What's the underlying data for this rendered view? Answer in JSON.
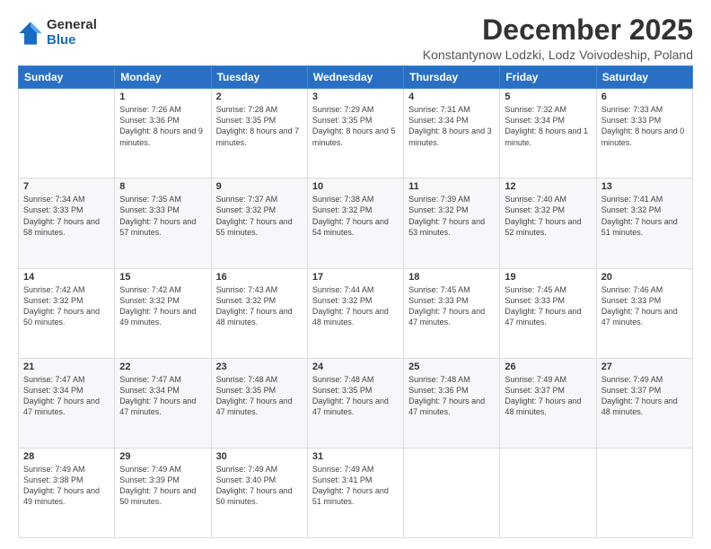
{
  "logo": {
    "general": "General",
    "blue": "Blue"
  },
  "title": "December 2025",
  "subtitle": "Konstantynow Lodzki, Lodz Voivodeship, Poland",
  "days": [
    "Sunday",
    "Monday",
    "Tuesday",
    "Wednesday",
    "Thursday",
    "Friday",
    "Saturday"
  ],
  "weeks": [
    [
      {
        "date": "",
        "sunrise": "",
        "sunset": "",
        "daylight": ""
      },
      {
        "date": "1",
        "sunrise": "Sunrise: 7:26 AM",
        "sunset": "Sunset: 3:36 PM",
        "daylight": "Daylight: 8 hours and 9 minutes."
      },
      {
        "date": "2",
        "sunrise": "Sunrise: 7:28 AM",
        "sunset": "Sunset: 3:35 PM",
        "daylight": "Daylight: 8 hours and 7 minutes."
      },
      {
        "date": "3",
        "sunrise": "Sunrise: 7:29 AM",
        "sunset": "Sunset: 3:35 PM",
        "daylight": "Daylight: 8 hours and 5 minutes."
      },
      {
        "date": "4",
        "sunrise": "Sunrise: 7:31 AM",
        "sunset": "Sunset: 3:34 PM",
        "daylight": "Daylight: 8 hours and 3 minutes."
      },
      {
        "date": "5",
        "sunrise": "Sunrise: 7:32 AM",
        "sunset": "Sunset: 3:34 PM",
        "daylight": "Daylight: 8 hours and 1 minute."
      },
      {
        "date": "6",
        "sunrise": "Sunrise: 7:33 AM",
        "sunset": "Sunset: 3:33 PM",
        "daylight": "Daylight: 8 hours and 0 minutes."
      }
    ],
    [
      {
        "date": "7",
        "sunrise": "Sunrise: 7:34 AM",
        "sunset": "Sunset: 3:33 PM",
        "daylight": "Daylight: 7 hours and 58 minutes."
      },
      {
        "date": "8",
        "sunrise": "Sunrise: 7:35 AM",
        "sunset": "Sunset: 3:33 PM",
        "daylight": "Daylight: 7 hours and 57 minutes."
      },
      {
        "date": "9",
        "sunrise": "Sunrise: 7:37 AM",
        "sunset": "Sunset: 3:32 PM",
        "daylight": "Daylight: 7 hours and 55 minutes."
      },
      {
        "date": "10",
        "sunrise": "Sunrise: 7:38 AM",
        "sunset": "Sunset: 3:32 PM",
        "daylight": "Daylight: 7 hours and 54 minutes."
      },
      {
        "date": "11",
        "sunrise": "Sunrise: 7:39 AM",
        "sunset": "Sunset: 3:32 PM",
        "daylight": "Daylight: 7 hours and 53 minutes."
      },
      {
        "date": "12",
        "sunrise": "Sunrise: 7:40 AM",
        "sunset": "Sunset: 3:32 PM",
        "daylight": "Daylight: 7 hours and 52 minutes."
      },
      {
        "date": "13",
        "sunrise": "Sunrise: 7:41 AM",
        "sunset": "Sunset: 3:32 PM",
        "daylight": "Daylight: 7 hours and 51 minutes."
      }
    ],
    [
      {
        "date": "14",
        "sunrise": "Sunrise: 7:42 AM",
        "sunset": "Sunset: 3:32 PM",
        "daylight": "Daylight: 7 hours and 50 minutes."
      },
      {
        "date": "15",
        "sunrise": "Sunrise: 7:42 AM",
        "sunset": "Sunset: 3:32 PM",
        "daylight": "Daylight: 7 hours and 49 minutes."
      },
      {
        "date": "16",
        "sunrise": "Sunrise: 7:43 AM",
        "sunset": "Sunset: 3:32 PM",
        "daylight": "Daylight: 7 hours and 48 minutes."
      },
      {
        "date": "17",
        "sunrise": "Sunrise: 7:44 AM",
        "sunset": "Sunset: 3:32 PM",
        "daylight": "Daylight: 7 hours and 48 minutes."
      },
      {
        "date": "18",
        "sunrise": "Sunrise: 7:45 AM",
        "sunset": "Sunset: 3:33 PM",
        "daylight": "Daylight: 7 hours and 47 minutes."
      },
      {
        "date": "19",
        "sunrise": "Sunrise: 7:45 AM",
        "sunset": "Sunset: 3:33 PM",
        "daylight": "Daylight: 7 hours and 47 minutes."
      },
      {
        "date": "20",
        "sunrise": "Sunrise: 7:46 AM",
        "sunset": "Sunset: 3:33 PM",
        "daylight": "Daylight: 7 hours and 47 minutes."
      }
    ],
    [
      {
        "date": "21",
        "sunrise": "Sunrise: 7:47 AM",
        "sunset": "Sunset: 3:34 PM",
        "daylight": "Daylight: 7 hours and 47 minutes."
      },
      {
        "date": "22",
        "sunrise": "Sunrise: 7:47 AM",
        "sunset": "Sunset: 3:34 PM",
        "daylight": "Daylight: 7 hours and 47 minutes."
      },
      {
        "date": "23",
        "sunrise": "Sunrise: 7:48 AM",
        "sunset": "Sunset: 3:35 PM",
        "daylight": "Daylight: 7 hours and 47 minutes."
      },
      {
        "date": "24",
        "sunrise": "Sunrise: 7:48 AM",
        "sunset": "Sunset: 3:35 PM",
        "daylight": "Daylight: 7 hours and 47 minutes."
      },
      {
        "date": "25",
        "sunrise": "Sunrise: 7:48 AM",
        "sunset": "Sunset: 3:36 PM",
        "daylight": "Daylight: 7 hours and 47 minutes."
      },
      {
        "date": "26",
        "sunrise": "Sunrise: 7:49 AM",
        "sunset": "Sunset: 3:37 PM",
        "daylight": "Daylight: 7 hours and 48 minutes."
      },
      {
        "date": "27",
        "sunrise": "Sunrise: 7:49 AM",
        "sunset": "Sunset: 3:37 PM",
        "daylight": "Daylight: 7 hours and 48 minutes."
      }
    ],
    [
      {
        "date": "28",
        "sunrise": "Sunrise: 7:49 AM",
        "sunset": "Sunset: 3:38 PM",
        "daylight": "Daylight: 7 hours and 49 minutes."
      },
      {
        "date": "29",
        "sunrise": "Sunrise: 7:49 AM",
        "sunset": "Sunset: 3:39 PM",
        "daylight": "Daylight: 7 hours and 50 minutes."
      },
      {
        "date": "30",
        "sunrise": "Sunrise: 7:49 AM",
        "sunset": "Sunset: 3:40 PM",
        "daylight": "Daylight: 7 hours and 50 minutes."
      },
      {
        "date": "31",
        "sunrise": "Sunrise: 7:49 AM",
        "sunset": "Sunset: 3:41 PM",
        "daylight": "Daylight: 7 hours and 51 minutes."
      },
      {
        "date": "",
        "sunrise": "",
        "sunset": "",
        "daylight": ""
      },
      {
        "date": "",
        "sunrise": "",
        "sunset": "",
        "daylight": ""
      },
      {
        "date": "",
        "sunrise": "",
        "sunset": "",
        "daylight": ""
      }
    ]
  ]
}
